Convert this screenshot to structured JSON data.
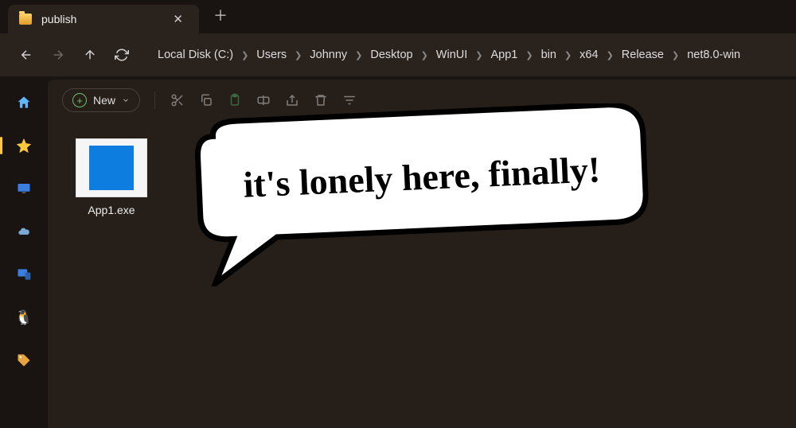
{
  "tab": {
    "title": "publish"
  },
  "breadcrumbs": [
    "Local Disk (C:)",
    "Users",
    "Johnny",
    "Desktop",
    "WinUI",
    "App1",
    "bin",
    "x64",
    "Release",
    "net8.0-win"
  ],
  "toolbar": {
    "new_label": "New"
  },
  "files": [
    {
      "name": "App1.exe"
    }
  ],
  "sidebar": {
    "items": [
      {
        "id": "home",
        "icon": "home-icon"
      },
      {
        "id": "favorites",
        "icon": "star-icon",
        "active": true
      },
      {
        "id": "desktop",
        "icon": "monitor-icon"
      },
      {
        "id": "onedrive",
        "icon": "cloud-icon"
      },
      {
        "id": "thispc",
        "icon": "pc-icon"
      },
      {
        "id": "linux",
        "icon": "penguin-icon"
      },
      {
        "id": "tags",
        "icon": "tag-icon"
      }
    ]
  },
  "annotation": {
    "speech_text": "it's lonely here, finally!"
  }
}
